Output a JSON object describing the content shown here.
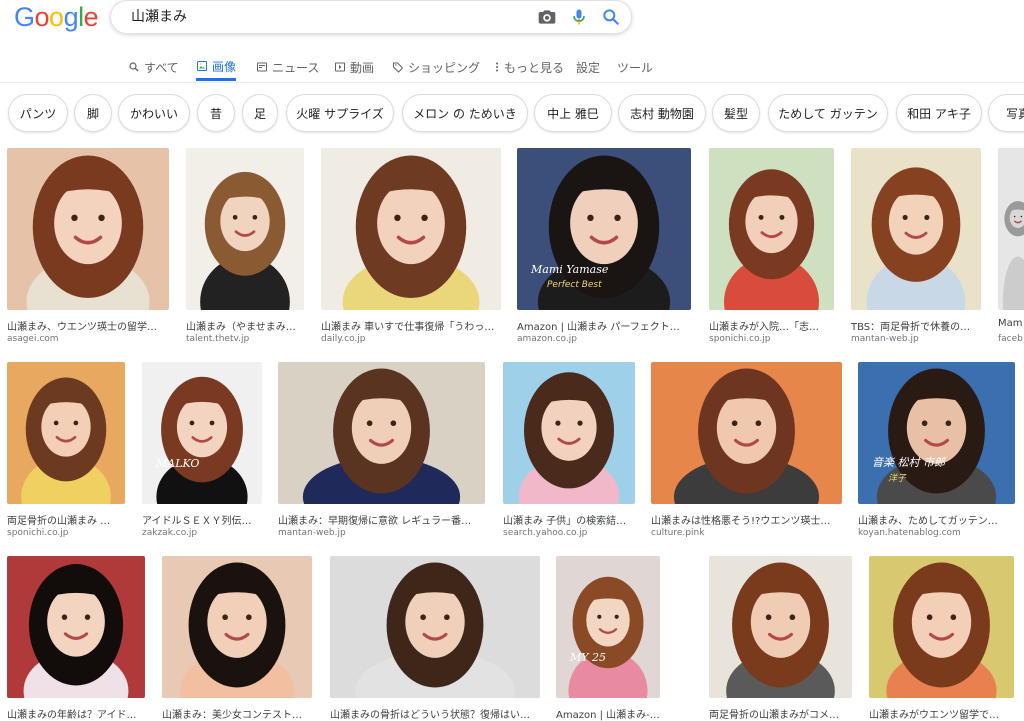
{
  "logo": {
    "text": "Google"
  },
  "search": {
    "query": "山瀬まみ"
  },
  "tabs": [
    {
      "label": "すべて",
      "icon": "search-icon"
    },
    {
      "label": "画像",
      "icon": "image-icon",
      "active": true
    },
    {
      "label": "ニュース",
      "icon": "news-icon"
    },
    {
      "label": "動画",
      "icon": "video-icon"
    },
    {
      "label": "ショッピング",
      "icon": "tag-icon"
    },
    {
      "label": "もっと見る",
      "icon": "more-vert-icon"
    },
    {
      "label": "設定"
    },
    {
      "label": "ツール"
    }
  ],
  "chips": [
    "パンツ",
    "脚",
    "かわいい",
    "昔",
    "足",
    "火曜 サプライズ",
    "メロン の ためいき",
    "中上 雅巳",
    "志村 動物園",
    "髪型",
    "ためして ガッテン",
    "和田 アキ子",
    "写真"
  ],
  "results": [
    {
      "caption": "山瀬まみ、ウエンツ瑛士の留学…",
      "source": "asagei.com"
    },
    {
      "caption": "山瀬まみ（やませまみ…",
      "source": "talent.thetv.jp"
    },
    {
      "caption": "山瀬まみ 車いすで仕事復帰「うわっ…",
      "source": "daily.co.jp"
    },
    {
      "caption": "Amazon | 山瀬まみ パーフェクト…",
      "source": "amazon.co.jp",
      "overlay1": "Mami Yamase",
      "overlay2": "Perfect Best"
    },
    {
      "caption": "山瀬まみが入院…「志…",
      "source": "sponichi.co.jp"
    },
    {
      "caption": "TBS：両足骨折で休養の…",
      "source": "mantan-web.jp"
    },
    {
      "caption": "Mam",
      "source": "faceb"
    },
    {
      "caption": "両足骨折の山瀬まみ …",
      "source": "sponichi.co.jp"
    },
    {
      "caption": "アイドルＳＥＸＹ列伝…",
      "source": "zakzak.co.jp",
      "overlay1": "MALKO"
    },
    {
      "caption": "山瀬まみ：早期復帰に意欲 レギュラー番…",
      "source": "mantan-web.jp"
    },
    {
      "caption": "山瀬まみ 子供」の検索結…",
      "source": "search.yahoo.co.jp"
    },
    {
      "caption": "山瀬まみは性格悪そう!?ウエンツ瑛士…",
      "source": "culture.pink"
    },
    {
      "caption": "山瀬まみ、ためしてガッテン…",
      "source": "koyan.hatenablog.com",
      "overlay1": "音楽 松村 市郎",
      "overlay2": "洋子"
    },
    {
      "caption": "山瀬まみの年齢は？アイド…",
      "source": ""
    },
    {
      "caption": "山瀬まみ：美少女コンテスト…",
      "source": ""
    },
    {
      "caption": "山瀬まみの骨折はどういう状態？復帰はい…",
      "source": ""
    },
    {
      "caption": "Amazon | 山瀬まみ-25th A…",
      "source": "",
      "overlay1": "MY 25"
    },
    {
      "caption": "両足骨折の山瀬まみがコメ…",
      "source": ""
    },
    {
      "caption": "山瀬まみがウエンツ留学で…",
      "source": ""
    }
  ],
  "colors": {
    "accent": "#1a73e8",
    "logo_blue": "#4285f4",
    "logo_red": "#ea4335",
    "logo_yellow": "#fbbc05",
    "logo_green": "#34a853"
  }
}
